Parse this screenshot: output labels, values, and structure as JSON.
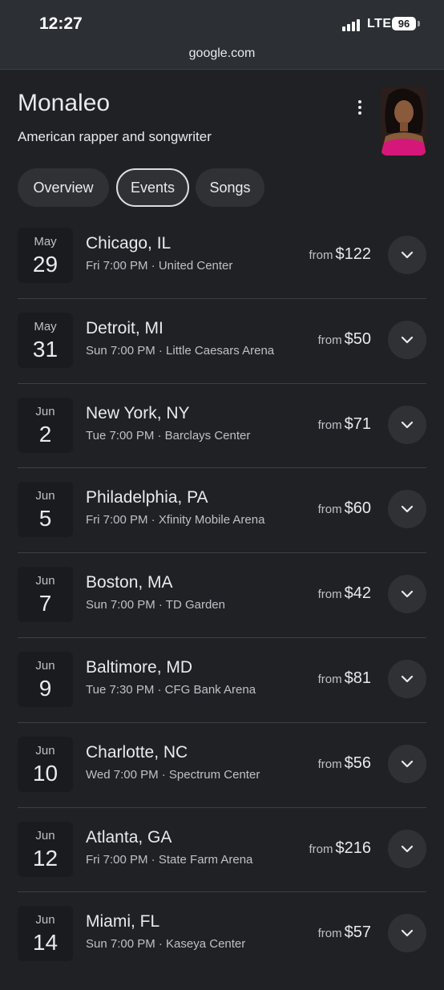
{
  "status": {
    "time": "12:27",
    "network": "LTE",
    "battery": "96"
  },
  "browser": {
    "url": "google.com"
  },
  "entity": {
    "name": "Monaleo",
    "description": "American rapper and songwriter"
  },
  "tabs": [
    {
      "label": "Overview",
      "active": false
    },
    {
      "label": "Events",
      "active": true
    },
    {
      "label": "Songs",
      "active": false
    }
  ],
  "events": [
    {
      "month": "May",
      "day": "29",
      "city": "Chicago, IL",
      "detail": "Fri 7:00 PM · United Center",
      "from": "from",
      "price": "$122"
    },
    {
      "month": "May",
      "day": "31",
      "city": "Detroit, MI",
      "detail": "Sun 7:00 PM · Little Caesars Arena",
      "from": "from",
      "price": "$50"
    },
    {
      "month": "Jun",
      "day": "2",
      "city": "New York, NY",
      "detail": "Tue 7:00 PM · Barclays Center",
      "from": "from",
      "price": "$71"
    },
    {
      "month": "Jun",
      "day": "5",
      "city": "Philadelphia, PA",
      "detail": "Fri 7:00 PM · Xfinity Mobile Arena",
      "from": "from",
      "price": "$60"
    },
    {
      "month": "Jun",
      "day": "7",
      "city": "Boston, MA",
      "detail": "Sun 7:00 PM · TD Garden",
      "from": "from",
      "price": "$42"
    },
    {
      "month": "Jun",
      "day": "9",
      "city": "Baltimore, MD",
      "detail": "Tue 7:30 PM · CFG Bank Arena",
      "from": "from",
      "price": "$81"
    },
    {
      "month": "Jun",
      "day": "10",
      "city": "Charlotte, NC",
      "detail": "Wed 7:00 PM · Spectrum Center",
      "from": "from",
      "price": "$56"
    },
    {
      "month": "Jun",
      "day": "12",
      "city": "Atlanta, GA",
      "detail": "Fri 7:00 PM · State Farm Arena",
      "from": "from",
      "price": "$216"
    },
    {
      "month": "Jun",
      "day": "14",
      "city": "Miami, FL",
      "detail": "Sun 7:00 PM · Kaseya Center",
      "from": "from",
      "price": "$57"
    }
  ],
  "icons": {
    "menu": "more-vert-icon",
    "expand": "chevron-down-icon",
    "signal": "signal-icon",
    "battery": "battery-icon"
  }
}
